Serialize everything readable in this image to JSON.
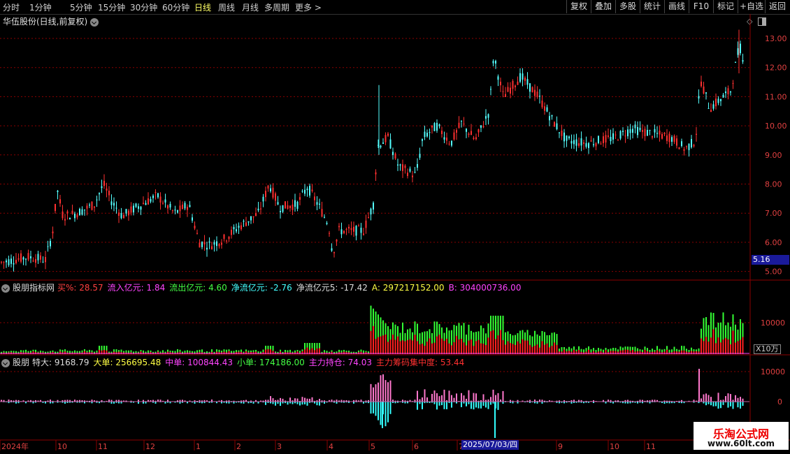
{
  "periods": [
    "分时",
    "1分钟",
    "5分钟",
    "15分钟",
    "30分钟",
    "60分钟",
    "日线",
    "周线",
    "月线",
    "多周期",
    "更多 >"
  ],
  "active_period": "日线",
  "toolbar": [
    "复权",
    "叠加",
    "多股",
    "统计",
    "画线",
    "F10",
    "标记",
    "+自选",
    "返回"
  ],
  "main_title": "华伍股份(日线,前复权)",
  "price_axis": [
    "13.00",
    "12.00",
    "11.00",
    "10.00",
    "9.00",
    "8.00",
    "7.00",
    "6.00",
    "5.00"
  ],
  "last_price": "5.16",
  "indicator1": {
    "name": "股朋指标网",
    "items": [
      {
        "label": "买%:",
        "value": "28.57",
        "color": "#ff4040"
      },
      {
        "label": "流入亿元:",
        "value": "1.84",
        "color": "#ff44ff"
      },
      {
        "label": "流出亿元:",
        "value": "4.60",
        "color": "#44ff44"
      },
      {
        "label": "净流亿元:",
        "value": "-2.76",
        "color": "#44ffff"
      },
      {
        "label": "净流亿元5:",
        "value": "-17.42",
        "color": "#dddddd"
      },
      {
        "label": "A:",
        "value": "297217152.00",
        "color": "#ffff44"
      },
      {
        "label": "B:",
        "value": "304000736.00",
        "color": "#ff44ff"
      }
    ],
    "axis": [
      "10000"
    ],
    "unit": "X10万"
  },
  "indicator2": {
    "name": "股朋",
    "items": [
      {
        "label": "特大:",
        "value": "9168.79",
        "color": "#dddddd"
      },
      {
        "label": "大单:",
        "value": "256695.48",
        "color": "#ffff44"
      },
      {
        "label": "中单:",
        "value": "100844.43",
        "color": "#ff44ff"
      },
      {
        "label": "小单:",
        "value": "174186.00",
        "color": "#44ff44"
      },
      {
        "label": "主力持仓:",
        "value": "74.03",
        "color": "#ff44ff"
      },
      {
        "label": "主力筹码集中度:",
        "value": "53.44",
        "color": "#ff3030"
      }
    ],
    "axis": [
      "10000",
      "0"
    ]
  },
  "x_axis": [
    "2024年",
    "10",
    "11",
    "12",
    "1",
    "2",
    "3",
    "4",
    "5",
    "6",
    "7",
    "9",
    "10",
    "11"
  ],
  "cursor_date": "2025/07/03/四",
  "watermark": {
    "line1": "乐淘公式网",
    "line2": "www.60lt.com"
  },
  "colors": {
    "up": "#ff3030",
    "down": "#54ffff",
    "grid": "#8b0000"
  }
}
